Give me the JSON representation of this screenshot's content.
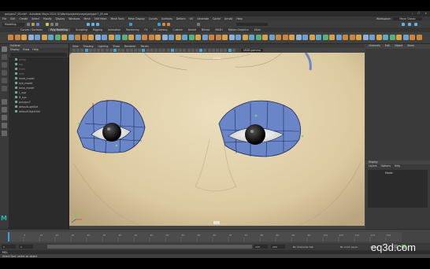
{
  "window": {
    "title": "polygon7_05.mb* - Autodesk Maya 2024: D:\\Work\\projects\\maya\\polygon7_05.mb",
    "controls": [
      "–",
      "☐",
      "✕"
    ]
  },
  "menubar": {
    "items": [
      "File",
      "Edit",
      "Create",
      "Select",
      "Modify",
      "Display",
      "Windows",
      "Mesh",
      "Edit Mesh",
      "Mesh Tools",
      "Mesh Display",
      "Curves",
      "Surfaces",
      "Deform",
      "UV",
      "Generate",
      "Cache",
      "Arnold",
      "Help"
    ],
    "workspace_label": "Workspace:",
    "workspace_value": "Maya Classic"
  },
  "statusline": {
    "mode": "Modeling"
  },
  "shelf": {
    "tabs": [
      "Curves / Surfaces",
      "Poly Modeling",
      "Sculpting",
      "Rigging",
      "Animation",
      "Rendering",
      "FX",
      "FX Caching",
      "Custom",
      "Arnold",
      "Bifrost",
      "MASH",
      "Motion Graphics",
      "XGen"
    ],
    "active_tab": "Poly Modeling"
  },
  "outliner": {
    "title": "Outliner",
    "menus": [
      "Display",
      "Show",
      "Help"
    ],
    "items": [
      {
        "label": "persp",
        "dim": true
      },
      {
        "label": "top",
        "dim": true
      },
      {
        "label": "front",
        "dim": true
      },
      {
        "label": "side",
        "dim": true
      },
      {
        "label": "head_model",
        "dim": false
      },
      {
        "label": "eye_model",
        "dim": false
      },
      {
        "label": "brow_model",
        "dim": false
      },
      {
        "label": "L_eye",
        "dim": false
      },
      {
        "label": "R_eye",
        "dim": false
      },
      {
        "label": "polygon7",
        "dim": false
      },
      {
        "label": "defaultLightSet",
        "dim": false
      },
      {
        "label": "defaultObjectSet",
        "dim": false
      }
    ]
  },
  "viewport": {
    "menus": [
      "View",
      "Shading",
      "Lighting",
      "Show",
      "Renderer",
      "Panels"
    ],
    "colorspace": "sRGB gamma",
    "camera_label": "persp"
  },
  "right_panel": {
    "tabs": [
      "Channels",
      "Edit",
      "Object",
      "Show"
    ],
    "layer_title": "Display",
    "layer_tabs": [
      "Layers",
      "Options",
      "Help"
    ],
    "layer_item": "Model"
  },
  "timeline": {
    "ticks": [
      "5",
      "10",
      "15",
      "20",
      "25",
      "30",
      "35",
      "40",
      "45",
      "50",
      "55",
      "60",
      "65",
      "70",
      "75",
      "80",
      "85",
      "90",
      "95",
      "100",
      "105",
      "110",
      "115",
      "120"
    ],
    "current_frame": "1"
  },
  "range": {
    "start": "1",
    "inner_start": "1",
    "inner_end": "120",
    "end": "200",
    "char_set": "No Character Set",
    "anim_layer": "No Anim Layer",
    "fps": "24 fps"
  },
  "cmdline": {
    "lang": "MEL"
  },
  "helpline": {
    "text": "Select Tool: select an object"
  },
  "watermark": "eq3d.com",
  "logo": "M",
  "colors": {
    "skin": "#e3d4b0",
    "mesh_blue": "#6a86c8",
    "wire": "#1d2b55",
    "selected": "#6fdc6f"
  }
}
